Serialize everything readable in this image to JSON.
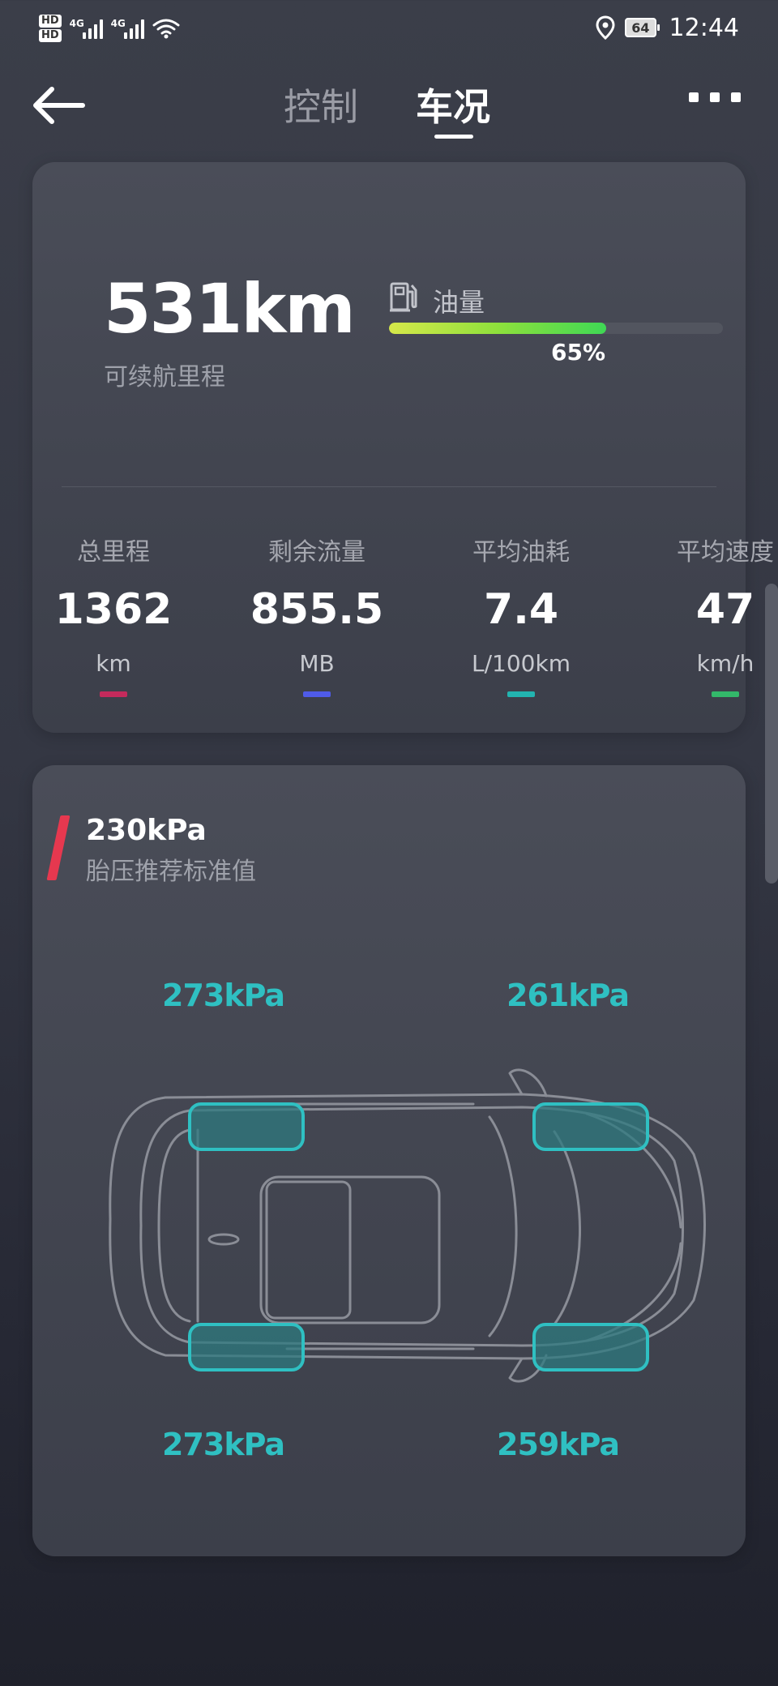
{
  "status_bar": {
    "hd_top": "HD",
    "hd_bottom": "HD",
    "network_1": "4G",
    "network_2": "4G",
    "battery": "64",
    "time": "12:44"
  },
  "header": {
    "tabs": [
      {
        "label": "控制",
        "active": false
      },
      {
        "label": "车况",
        "active": true
      }
    ]
  },
  "summary": {
    "range_value": "531km",
    "range_label": "可续航里程",
    "fuel_label": "油量",
    "fuel_percent": 65,
    "fuel_percent_text": "65%"
  },
  "stats": [
    {
      "label": "总里程",
      "value": "1362",
      "unit": "km",
      "color": "#c42a5c"
    },
    {
      "label": "剩余流量",
      "value": "855.5",
      "unit": "MB",
      "color": "#4f5be8"
    },
    {
      "label": "平均油耗",
      "value": "7.4",
      "unit": "L/100km",
      "color": "#22b4b0"
    },
    {
      "label": "平均速度",
      "value": "47",
      "unit": "km/h",
      "color": "#33b86a"
    }
  ],
  "tire_pressure": {
    "recommended_value": "230kPa",
    "recommended_label": "胎压推荐标准值",
    "front_left": "273kPa",
    "front_right": "261kPa",
    "rear_left": "273kPa",
    "rear_right": "259kPa",
    "tire_color": "#2fc0c2"
  },
  "colors": {
    "accent_red": "#e6384f",
    "fuel_gradient_start": "#d6e84a",
    "fuel_gradient_end": "#3fd855"
  }
}
